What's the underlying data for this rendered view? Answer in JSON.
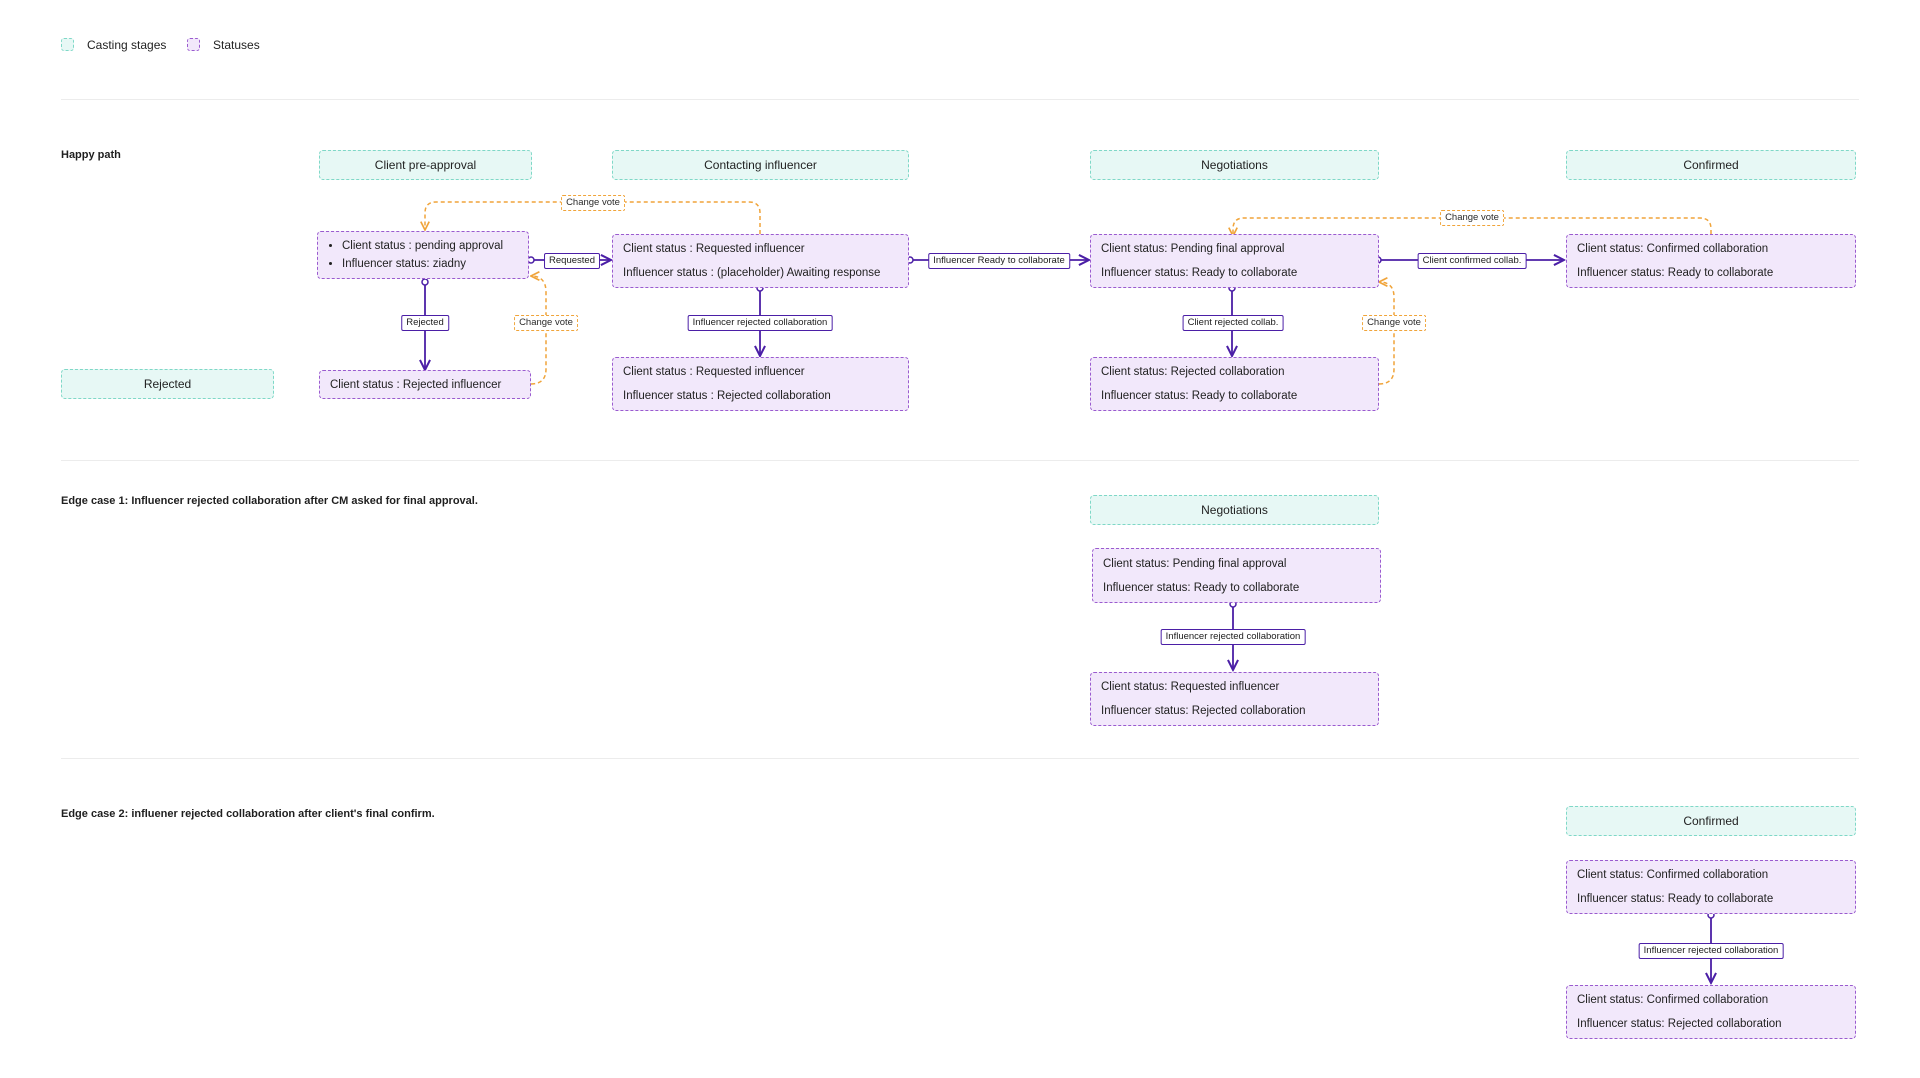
{
  "legend": {
    "casting_stages": "Casting stages",
    "statuses": "Statuses"
  },
  "sections": {
    "happy_path": "Happy path",
    "edge_case_1": "Edge case 1: Influencer rejected collaboration after CM asked for final approval.",
    "edge_case_2": "Edge case 2: influener rejected collaboration after client's final confirm."
  },
  "stages": {
    "client_pre_approval": "Client pre-approval",
    "contacting_influencer": "Contacting influencer",
    "negotiations": "Negotiations",
    "confirmed": "Confirmed",
    "rejected": "Rejected",
    "negotiations_ec1": "Negotiations",
    "confirmed_ec2": "Confirmed"
  },
  "statuses": {
    "pending_approval": {
      "line1": "Client status : pending approval",
      "line2": "Influencer status: ziadny"
    },
    "rejected_influencer": {
      "line1": "Client status : Rejected influencer"
    },
    "requested_influencer": {
      "line1": "Client status : Requested influencer",
      "line2": "Influencer status : (placeholder) Awaiting response"
    },
    "requested_rejected": {
      "line1": "Client status : Requested influencer",
      "line2": "Influencer status : Rejected collaboration"
    },
    "pending_final": {
      "line1": "Client status: Pending final approval",
      "line2": "Influencer status: Ready to collaborate"
    },
    "rejected_collab": {
      "line1": "Client status: Rejected collaboration",
      "line2": "Influencer status: Ready to collaborate"
    },
    "confirmed_collab": {
      "line1": "Client status: Confirmed collaboration",
      "line2": "Influencer status: Ready to collaborate"
    },
    "ec1_pending": {
      "line1": "Client status: Pending final approval",
      "line2": "Influencer status: Ready to collaborate"
    },
    "ec1_result": {
      "line1": "Client status: Requested influencer",
      "line2": "Influencer status: Rejected collaboration"
    },
    "ec2_confirmed": {
      "line1": "Client status: Confirmed collaboration",
      "line2": "Influencer status: Ready to collaborate"
    },
    "ec2_result": {
      "line1": "Client status: Confirmed collaboration",
      "line2": "Influencer status: Rejected collaboration"
    }
  },
  "edges": {
    "requested": "Requested",
    "rejected": "Rejected",
    "change_vote_1": "Change vote",
    "change_vote_2": "Change vote",
    "influencer_rejected_1": "Influencer rejected collaboration",
    "influencer_ready": "Influencer Ready to collaborate",
    "client_rejected": "Client rejected collab.",
    "change_vote_3": "Change vote",
    "change_vote_4": "Change vote",
    "client_confirmed": "Client confirmed collab.",
    "ec1_influencer_rejected": "Influencer rejected collaboration",
    "ec2_influencer_rejected": "Influencer rejected collaboration"
  },
  "colors": {
    "stage_fill": "#e7f8f5",
    "stage_border": "#7fd8c7",
    "status_fill": "#f2e8fb",
    "status_border": "#9a5bcf",
    "flow_line": "#4b1fa6",
    "vote_line": "#f0a43a"
  }
}
